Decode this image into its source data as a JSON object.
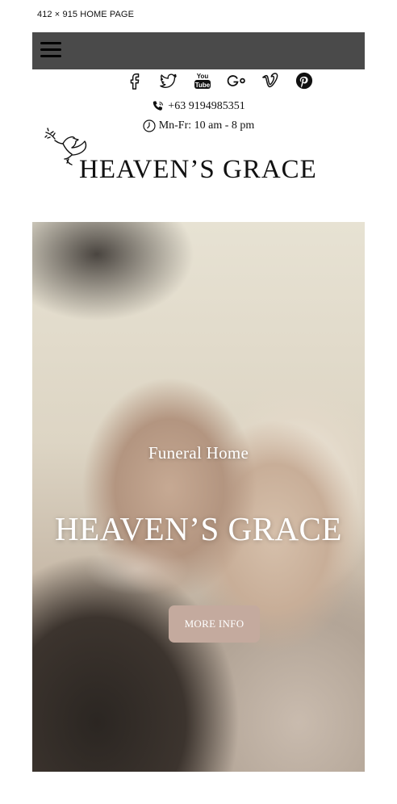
{
  "caption": "412 × 915 HOME PAGE",
  "header": {
    "menu_icon": "hamburger-menu-icon",
    "socials": [
      {
        "name": "facebook-icon"
      },
      {
        "name": "twitter-icon"
      },
      {
        "name": "youtube-icon"
      },
      {
        "name": "google-plus-icon"
      },
      {
        "name": "vimeo-icon"
      },
      {
        "name": "pinterest-icon"
      }
    ],
    "phone": "+63 9194985351",
    "hours": "Mn-Fr: 10 am - 8 pm",
    "logo_text": "HEAVEN’S GRACE"
  },
  "hero": {
    "subtitle": "Funeral Home",
    "title": "HEAVEN’S GRACE",
    "button_label": "MORE INFO",
    "button_color": "#c4aa9e"
  },
  "colors": {
    "navbar": "#4a4a4a",
    "text": "#111111"
  }
}
